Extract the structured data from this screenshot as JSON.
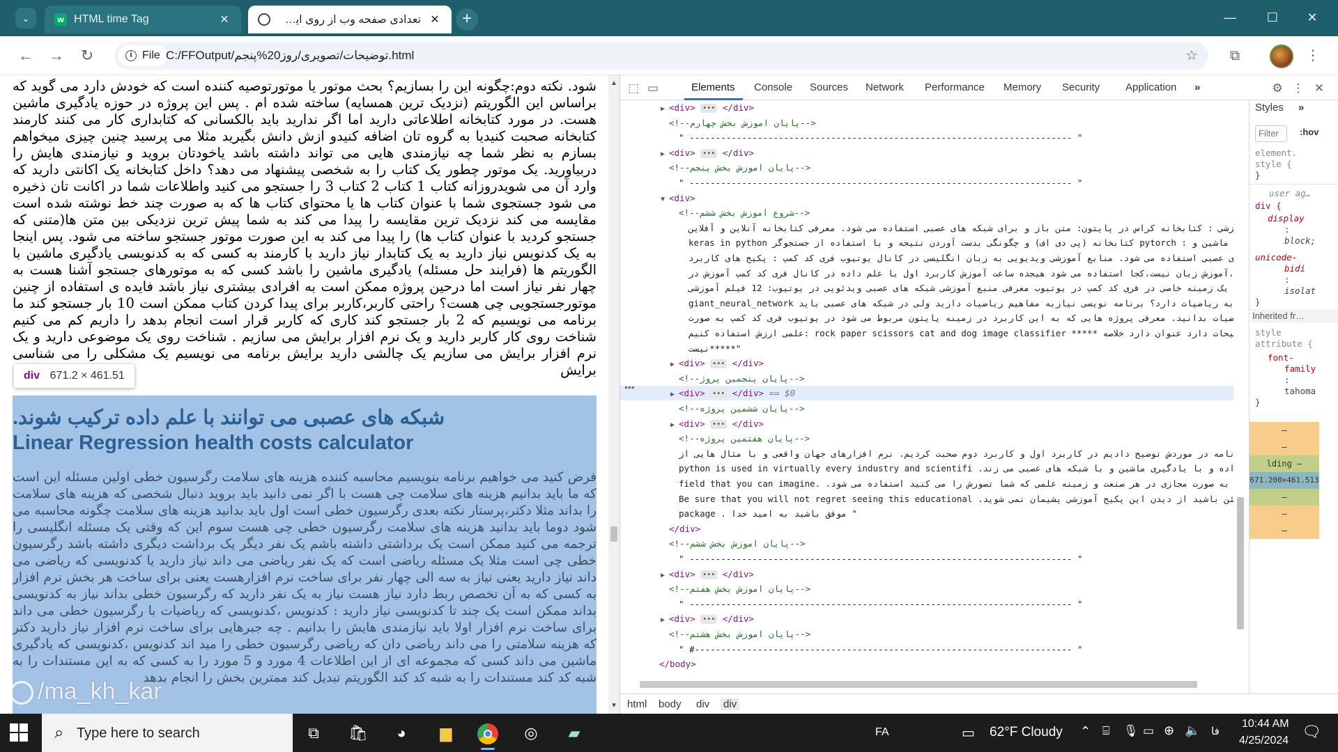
{
  "browser": {
    "tabs": [
      {
        "title": "HTML time Tag",
        "active": false
      },
      {
        "title": "تعدادی صفحه وب از روی این توض",
        "active": true
      }
    ],
    "tab_close_glyph": "✕",
    "new_tab_glyph": "+",
    "window_controls": {
      "minimize": "—",
      "maximize": "☐",
      "close": "✕"
    },
    "site_chip": "File",
    "url": "C:/FFOutput/توضیحات/تصویری/روز20%پنجم.html"
  },
  "page": {
    "paragraph": "شود. نکته دوم:چگونه این را بسازیم؟ بحث موتور یا موتورتوصیه کننده است که خودش دارد می گوید که براساس این الگوریتم (نزدیک ترین همسایه) ساخته شده ام . پس این پروژه در حوزه یادگیری ماشین هست. در مورد کتابخانه اطلاعاتی دارید اما اگر ندارید باید بالکسانی که کتابداری کار می کنند کارمند کتابخانه صحبت کنیدیا به گروه تان اضافه کنیدو ازش دانش بگیرید مثلا می پرسید چنین چیزی میخواهم بسازم به نظر شما چه نیازمندی هایی می تواند داشته باشد یاخودتان بروید و نیازمندی هایش را دربیاورید. یک موتور چطور یک کتاب را به شخصی پیشنهاد می دهد؟ داخل کتابخانه یک اکانتی دارید که وارد آن می شویدروزانه کتاب 1 کتاب 2 کتاب 3 را جستجو می کنید واطلاعات شما در اکانت تان ذخیره می شود جستجوی شما با عنوان کتاب ها یا محتوای کتاب ها که به صورت چند خط نوشته شده است مقایسه می کند نزدیک ترین مقایسه را پیدا می کند به شما پیش ترین نزدیکی بین متن ها(متنی که جستجو کردید با عنوان کتاب ها) را پیدا می کند به این صورت موتور جستجو ساخته می شود. پس اینجا به یک کدنویس نیاز دارید به یک کتابدار نیاز دارید با کارمند به کسی که به کدنویسی یادگیری ماشین با الگوریتم ها (فرایند حل مسئله) یادگیری ماشین را باشد کسی که به موتورهای جستجو آشنا هست به چهار نفر نیاز است اما درحین پروژه ممکن است به افرادی بیشتری نیاز باشد فایده ی استفاده از چنین موتورجستجویی چی هست؟ راحتی کاربر،کاربر برای پیدا کردن کتاب ممکن است 10 بار جستجو کند ما برنامه می نویسیم که 2 بار جستجو کند کاری که کاربر قرار است انجام بدهد را داریم کم می کنیم شناخت روی کار کاربر دارید و یک نرم افزار برایش می سازیم . شناخت روی یک موضوعی دارید و یک نرم افزار برایش می سازیم یک چالشی دارید برایش برنامه می نویسیم یک مشکلی را می شناسی برایش",
    "tooltip_tag": "div",
    "tooltip_size": "671.2 × 461.51",
    "heading_fa": "شبکه های عصبی می توانند با علم داده ترکیب شوند.",
    "heading_en": "Linear Regression health costs calculator",
    "highlight_text": "فرض کنید می خواهیم برنامه بنویسیم محاسبه کننده هزینه های سلامت رگرسیون خطی اولین مسئله این است که ما باید بدانیم هزینه های سلامت چی هست با اگر نمی دانید باید بروید دنبال شخصی که هزینه های سلامت را بداند مثلا دکتر،پرستار نکته بعدی رگرسیون خطی است اول باید بدانید هزینه های سلامت چگونه محاسبه می شود دوما باید بدانید هزینه های سلامت رگرسیون خطی چی هست سوم این که وقتی یک مسئله انگلیسی را ترجمه می کنید ممکن است یک برداشتی داشته باشم یک نفر دیگر یک برداشت دیگری داشته باشد رگرسیون خطی چی است مثلا یک مسئله ریاضی است که یک نفر ریاضی می داند نیاز دارید یا کدنویسی که ریاضی می داند نیاز دارید یعنی نیاز به سه الی چهار نفر برای ساخت نرم افزارهست یعنی برای ساخت هر بخش نرم افزار به کسی که به آن تخصص ربط دارد نیاز هست نیاز به یک نفر دارید که رگرسیون خطی بداند نیاز به کدنویسی بداند ممکن است یک چند تا کدنویسی نیاز دارید : کدنویس ،کدنویسی که ریاضیات با رگرسیون خطی می داند برای ساخت نرم افزار اولا باید نیازمندی هایش را بدانیم . چه جبرهایی برای ساخت نرم افزار نیاز دارید دکتر که هزینه سلامتی را می داند ریاضی دان که ریاضی رگرسیون خطی را مید اند کدنویس ،کدنویسی که یادگیری ماشین می داند کسی که مجموعه ای از این اطلاعات 4 مورد و 5 مورد را به کسی که به این مستندات را به شبه کد کند مستندات را به شبه کد کند الگوریتم تبدیل کند ممترین بخش را انجام بدهد",
    "watermark": "/ma_kh_kar"
  },
  "devtools": {
    "tabs": [
      "Elements",
      "Console",
      "Sources",
      "Network",
      "Performance",
      "Memory",
      "Security",
      "Application"
    ],
    "more_tabs": "»",
    "dom_lines": [
      {
        "indent": 1,
        "tri": "▶",
        "kind": "div"
      },
      {
        "indent": 1,
        "kind": "comment",
        "text": "<!--پایان اموزش بخش چهارم-->"
      },
      {
        "indent": 2,
        "kind": "text",
        "text": "\" ------------------------------------------------------------------------- \""
      },
      {
        "indent": 1,
        "tri": "▶",
        "kind": "div"
      },
      {
        "indent": 1,
        "kind": "comment",
        "text": "<!--پایان اموزش بخش پنجم-->"
      },
      {
        "indent": 2,
        "kind": "text",
        "text": "\" ------------------------------------------------------------------------- \""
      },
      {
        "indent": 1,
        "tri": "▼",
        "kind": "open",
        "text": "<div>"
      },
      {
        "indent": 2,
        "kind": "comment",
        "text": "<!--شروع اموزش بخش ششم-->"
      },
      {
        "indent": 3,
        "kind": "rtl",
        "text": "\" به نام خدا سلام موارد آموزشی : کتابخانه کراس در پایتون: متن باز و برای شبکه های عصبی استفاده می شود. معرفی کتابخانه آنلاین و آفلاین"
      },
      {
        "indent": 3,
        "kind": "rtl",
        "text": "کتابخانه برای یادگیری ماشین و : pytorch کتابخانه (پی دی اف) و چگونگی بدست آوردن نتیجه و با استفاده از جستجوگر keras in python"
      },
      {
        "indent": 3,
        "kind": "rtl",
        "text": "توسعه و آموزش شبکه های عصبی استفاده می شود. منابع آموزشی ویدیویی به زبان انگلیسی در کانال یوتیوب فری کد کمپ : پکیج های کاربرد"
      },
      {
        "indent": 3,
        "kind": "rtl",
        "text": "همه محور نیست ،آموزش زبان نیست،کجا استفاده می شود هیجده ساعت آموزش کاربرد اول با علم داده در کانال فری کد کمپ آموزش در"
      },
      {
        "indent": 3,
        "kind": "rtl",
        "text": ":پایتون و پایتون در یک زمینه خاصی در فری کد کمپ در یوتیوب معرفی منبع آموزشی شبکه های عصبی ویدئویی در یوتیوب: 12 فیلم آموزشی"
      },
      {
        "indent": 3,
        "kind": "rtl",
        "text": "آیا برنامه نویس نیاز به ریاضیات دارد؟ برنامه نویسی نیازبه مفاهیم ریاضیات دارید ولی در شبکه های عصبی باید giant_neural_network"
      },
      {
        "indent": 3,
        "kind": "rtl",
        "text": "سی ریاضیات بدانید. معرفی پروژه هایی که به این کاربرد در زمینه پایتون مربوط می شود در یوتیوب فری کد کمپ به صورت"
      },
      {
        "indent": 3,
        "kind": "rtl",
        "text": "توضیحات دارد عنوان دارد خلاصه ***** rock paper scissors cat and dog image classifier :علمی ارزش استفاده کنیم"
      },
      {
        "indent": 3,
        "kind": "rtl",
        "text": "\"*****نیست"
      },
      {
        "indent": 2,
        "tri": "▶",
        "kind": "div"
      },
      {
        "indent": 2,
        "kind": "comment",
        "text": "<!--پایان پنجمین پروژ-->"
      },
      {
        "indent": 2,
        "tri": "▶",
        "kind": "div-selected",
        "suffix": "== $0"
      },
      {
        "indent": 2,
        "kind": "comment",
        "text": "<!--پایان ششمین پروژه-->"
      },
      {
        "indent": 2,
        "tri": "▶",
        "kind": "div"
      },
      {
        "indent": 2,
        "kind": "comment",
        "text": "<!--پایان هفتمین پروژه-->"
      },
      {
        "indent": 2,
        "kind": "rtl",
        "text": "\" وازده مورد که در اول برنامه در موردش توضیح دادیم در کاربرد اول و کاربرد دوم صحبت کردیم. نرم افزارهای جهان واقعی و با مثال هایی از"
      },
      {
        "indent": 2,
        "kind": "rtl",
        "text": "python is used in virtually every industry and scientifi .بحث علم داده و با یادگیری ماشین و با شبکه های عصبی می زند"
      },
      {
        "indent": 2,
        "kind": "rtl",
        "text": "field that you can imagine. .پایتون به صورت مجازی در هر صنعت و زمینه علمی که شما تصورش را می کنید استفاده می شود"
      },
      {
        "indent": 2,
        "kind": "rtl",
        "text": "Be sure that you will not regret seeing this educational .مطمئن باشید از دیدن این پکیج آموزشی پشیمان نمی شوید"
      },
      {
        "indent": 2,
        "kind": "rtl",
        "text": "package . موفق باشید به امید خدا \""
      },
      {
        "indent": 1,
        "kind": "close",
        "text": "</div>"
      },
      {
        "indent": 1,
        "kind": "comment",
        "text": "<!--پایان اموزش بخش ششم-->"
      },
      {
        "indent": 2,
        "kind": "text",
        "text": "\" ------------------------------------------------------------------------- \""
      },
      {
        "indent": 1,
        "tri": "▶",
        "kind": "div"
      },
      {
        "indent": 1,
        "kind": "comment",
        "text": "<!--پایان اموزش بخش هفتم-->"
      },
      {
        "indent": 2,
        "kind": "text",
        "text": "\" ------------------------------------------------------------------------- \""
      },
      {
        "indent": 1,
        "tri": "▶",
        "kind": "div"
      },
      {
        "indent": 1,
        "kind": "comment",
        "text": "<!--پایان اموزش بخش هشتم-->"
      },
      {
        "indent": 2,
        "kind": "text",
        "text": "\" #------------------------------------------------------------------------ \""
      },
      {
        "indent": 0,
        "kind": "close",
        "text": "</body>"
      },
      {
        "indent": -1,
        "kind": "close",
        "text": "</html>"
      }
    ],
    "breadcrumbs": [
      "html",
      "body",
      "div",
      "div"
    ],
    "styles": {
      "tab": "Styles",
      "more": "»",
      "filter_placeholder": "Filter",
      "hov": ":hov",
      "element_style": [
        "element.",
        "style {",
        "}"
      ],
      "user_agent": [
        "user ag…",
        "div {",
        "display",
        ":",
        "block;"
      ],
      "unicode": [
        "unicode-",
        "bidi",
        ":",
        "isolat",
        "}"
      ],
      "inherited": "Inherited fr…",
      "style_attr": [
        "style",
        "attribute {",
        "font-",
        "family",
        ":",
        "tahoma",
        "}"
      ],
      "box_model": {
        "margin": "–",
        "border": "–",
        "padding": "lding –",
        "content": "671.200×461.513"
      }
    }
  },
  "taskbar": {
    "search_placeholder": "Type here to search",
    "language": "FA",
    "weather": "62°F  Cloudy",
    "time": "10:44 AM",
    "date": "4/25/2024",
    "colors": {
      "highlight": "#a2c2e6",
      "tab_strip": "#1e5f6b",
      "accent": "#1a73e8"
    }
  }
}
